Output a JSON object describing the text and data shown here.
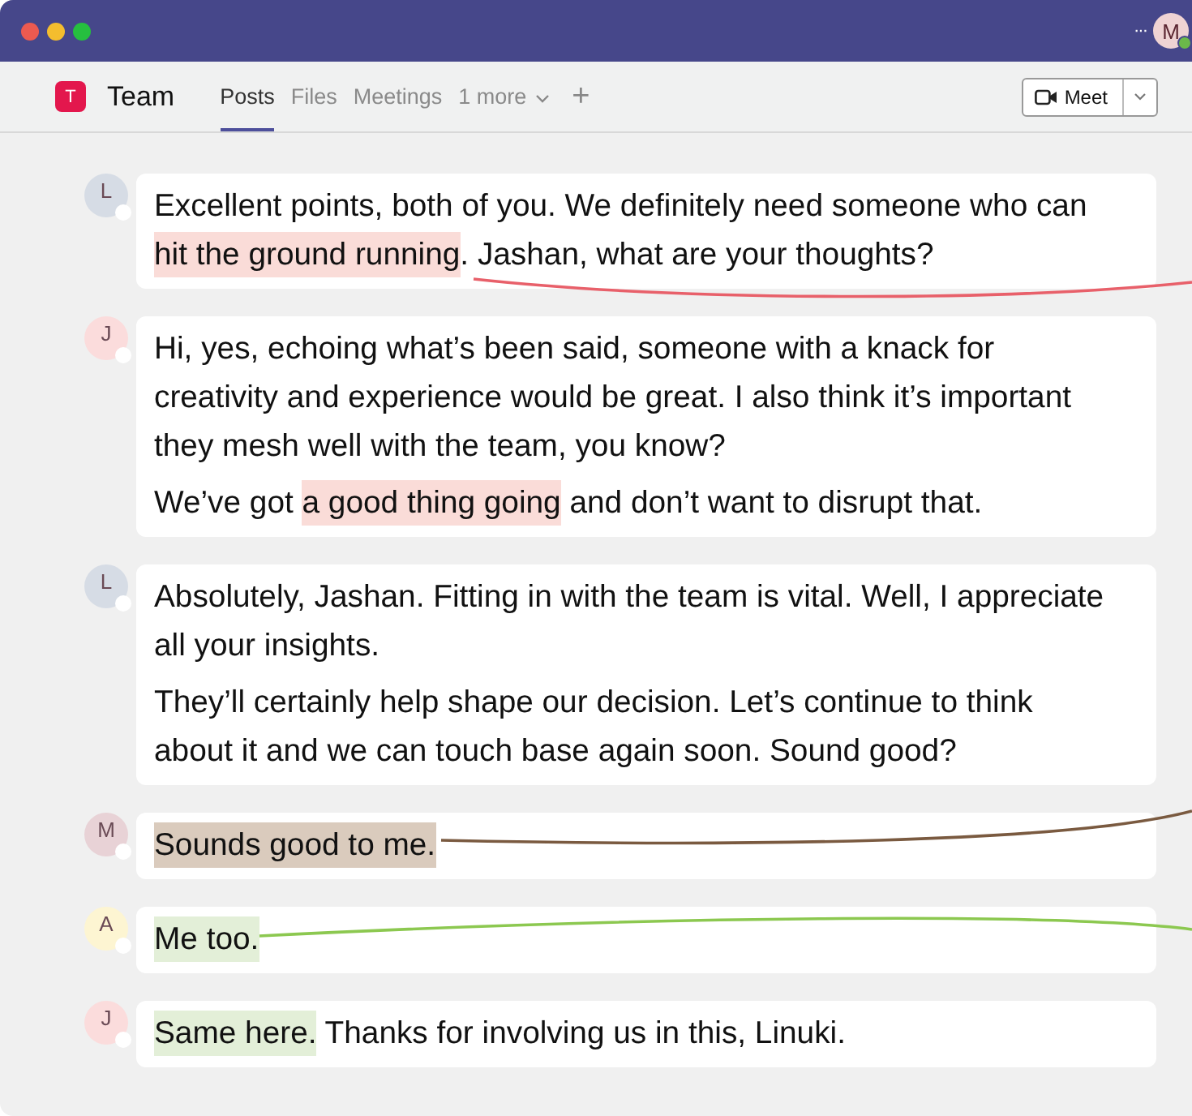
{
  "title_bar": {
    "avatar": "M",
    "more": "···"
  },
  "header": {
    "team_icon": "T",
    "team_name": "Team",
    "tabs": [
      {
        "label": "Posts",
        "selected": true
      },
      {
        "label": "Files",
        "selected": false
      },
      {
        "label": "Meetings",
        "selected": false
      },
      {
        "label": "1 more",
        "selected": false,
        "kind": "overflow"
      }
    ],
    "add": "+",
    "meet_button": "Meet"
  },
  "messages": [
    {
      "avatar": "L",
      "color": "#d6dce5",
      "paragraphs": [
        [
          {
            "text": "Excellent points, both of you. We definitely need someone who can "
          },
          {
            "text": "hit the ground running",
            "color": "#fadcd8"
          },
          {
            "text": ". Jashan, what are your thoughts?"
          }
        ]
      ]
    },
    {
      "avatar": "J",
      "color": "#fbdcdc",
      "paragraphs": [
        [
          {
            "text": "Hi, yes, echoing what’s been said, someone with a knack for creativity and experience would be great. I also think it’s important they mesh well with the team, you know?"
          }
        ],
        [
          {
            "text": "We’ve got "
          },
          {
            "text": "a good thing going",
            "color": "#fadcd8"
          },
          {
            "text": " and don’t want to disrupt that."
          }
        ]
      ]
    },
    {
      "avatar": "L",
      "color": "#d6dce5",
      "paragraphs": [
        [
          {
            "text": "Absolutely, Jashan. Fitting in with the team is vital. Well, I appreciate all your insights."
          }
        ],
        [
          {
            "text": "They’ll certainly help shape our decision. Let’s continue to think about it and we can touch base again soon. Sound good?"
          }
        ]
      ]
    },
    {
      "avatar": "M",
      "color": "#e8d2d6",
      "paragraphs": [
        [
          {
            "text": "Sounds good to me.",
            "color": "#dacbbd"
          }
        ]
      ]
    },
    {
      "avatar": "A",
      "color": "#fdf5d2",
      "paragraphs": [
        [
          {
            "text": "Me too.",
            "color": "#e3efd8"
          }
        ]
      ]
    },
    {
      "avatar": "J",
      "color": "#fbdcdc",
      "paragraphs": [
        [
          {
            "text": "Same here.",
            "color": "#e3efd8"
          },
          {
            "text": " Thanks for involving us in this, Linuki."
          }
        ]
      ]
    }
  ],
  "connectors": [
    {
      "color": "#e8606a"
    },
    {
      "color": "#7a5a40"
    },
    {
      "color": "#8cc850"
    }
  ]
}
